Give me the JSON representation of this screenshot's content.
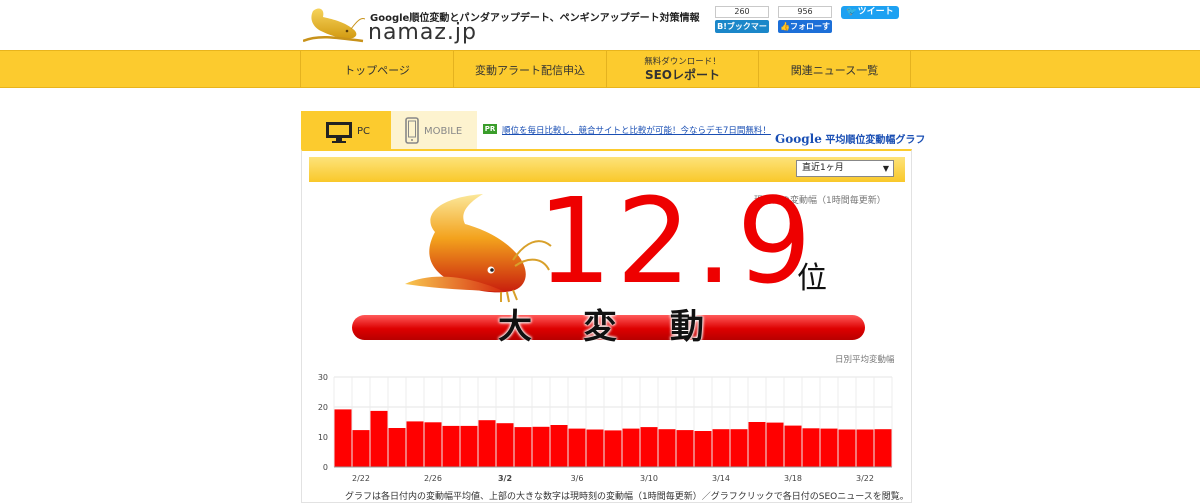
{
  "header": {
    "tagline": "Google順位変動とパンダアップデート、ペンギンアップデート対策情報",
    "site_name": "namaz.jp",
    "share": {
      "hatena_count": "260",
      "hatena_label": "B!ブックマーク",
      "follow_count": "956",
      "follow_label": "フォローする",
      "tweet_label": "ツイート"
    }
  },
  "nav": {
    "items": [
      {
        "label": "トップページ"
      },
      {
        "label": "変動アラート配信申込"
      },
      {
        "small": "無料ダウンロード！",
        "big": "SEOレポート"
      },
      {
        "label": "関連ニュース一覧"
      }
    ]
  },
  "tabs": {
    "pc": "PC",
    "mobile": "MOBILE"
  },
  "promo": {
    "badge": "PR",
    "text": "順位を毎日比較し、競合サイトと比較が可能！今ならデモ7日間無料！"
  },
  "graph_title": {
    "google": "Google",
    "text": "平均順位変動幅グラフ"
  },
  "period_select": {
    "value": "直近1ヶ月"
  },
  "current": {
    "label": "現時刻の変動幅（1時間毎更新）",
    "value": "12.9",
    "unit": "位",
    "status": [
      "大",
      "変",
      "動"
    ]
  },
  "daily_label": "日別平均変動幅",
  "caption": "グラフは各日付内の変動幅平均値、上部の大きな数字は現時刻の変動幅（1時間毎更新）／グラフクリックで各日付のSEOニュースを閲覧。",
  "colors": {
    "accent": "#fccb2e",
    "bar": "#ff0000",
    "big_number": "#ee0000"
  },
  "chart_data": {
    "type": "bar",
    "ylim": [
      0,
      30
    ],
    "yticks": [
      0,
      10,
      20,
      30
    ],
    "x": [
      "2/21",
      "2/22",
      "2/23",
      "2/24",
      "2/25",
      "2/26",
      "2/27",
      "2/28",
      "3/1",
      "3/2",
      "3/3",
      "3/4",
      "3/5",
      "3/6",
      "3/7",
      "3/8",
      "3/9",
      "3/10",
      "3/11",
      "3/12",
      "3/13",
      "3/14",
      "3/15",
      "3/16",
      "3/17",
      "3/18",
      "3/19",
      "3/20",
      "3/21",
      "3/22",
      "3/23"
    ],
    "values": [
      19.2,
      12.3,
      18.7,
      13.0,
      15.2,
      14.9,
      13.7,
      13.7,
      15.6,
      14.6,
      13.3,
      13.4,
      14.0,
      12.8,
      12.5,
      12.2,
      12.8,
      13.3,
      12.6,
      12.3,
      12.0,
      12.6,
      12.6,
      15.0,
      14.8,
      13.8,
      12.9,
      12.8,
      12.5,
      12.5,
      12.6
    ],
    "xticks": [
      "2/22",
      "2/26",
      "3/2",
      "3/6",
      "3/10",
      "3/14",
      "3/18",
      "3/22"
    ],
    "bold_ticks": [
      "3/2"
    ],
    "grid": true
  }
}
